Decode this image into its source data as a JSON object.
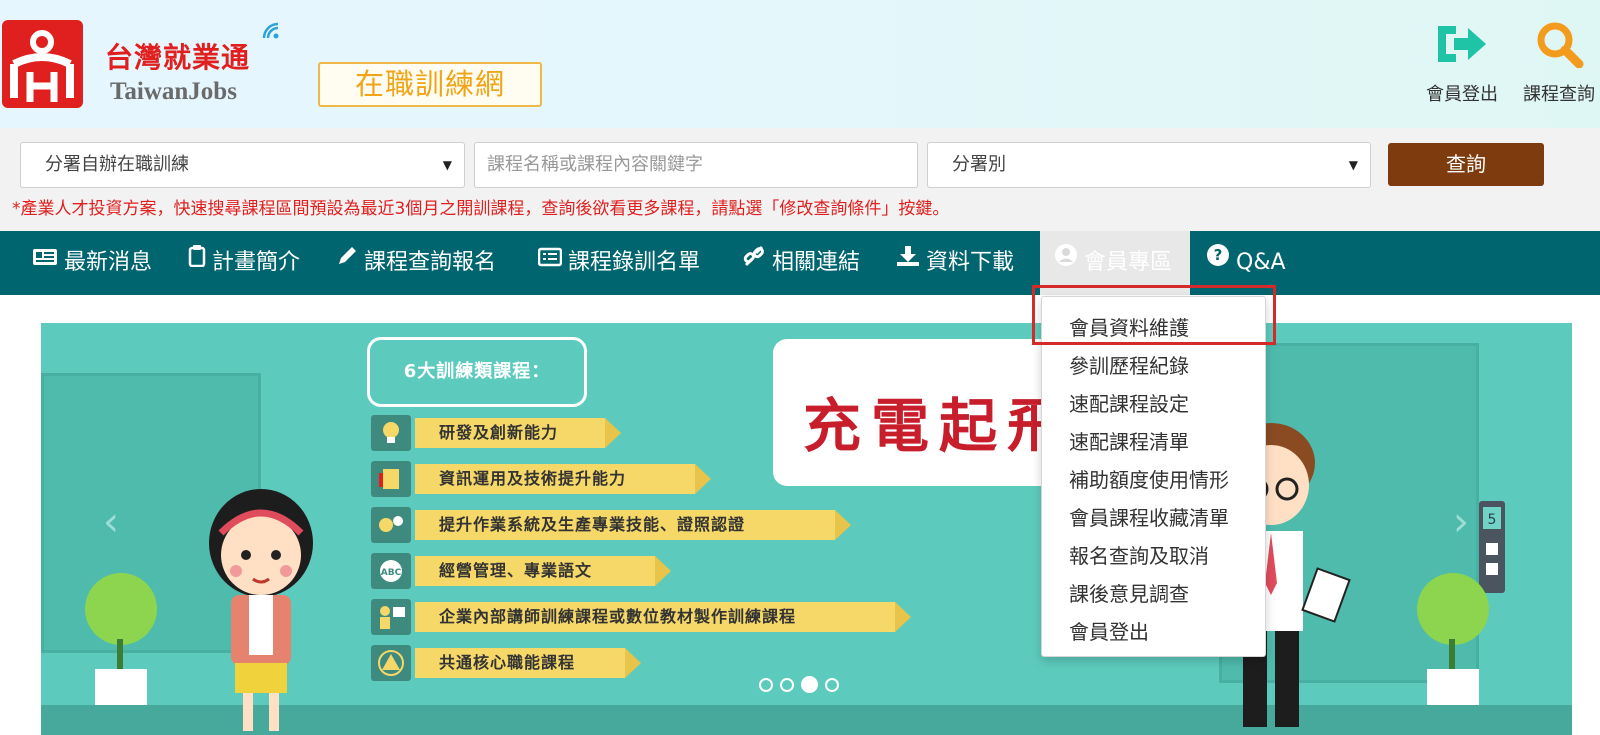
{
  "header": {
    "brand_cn": "台灣就業通",
    "brand_en": "TaiwanJobs",
    "portal_name": "在職訓練網",
    "logout_label": "會員登出",
    "course_search_label": "課程查詢"
  },
  "search": {
    "category_value": "分署自辦在職訓練",
    "keyword_placeholder": "課程名稱或課程內容關鍵字",
    "branch_value": "分署別",
    "query_button": "查詢",
    "notice": "*產業人才投資方案，快速搜尋課程區間預設為最近3個月之開訓課程，查詢後欲看更多課程，請點選「修改查詢條件」按鍵。"
  },
  "nav": {
    "items": [
      {
        "label": "最新消息",
        "icon": "news-icon"
      },
      {
        "label": "計畫簡介",
        "icon": "clipboard-icon"
      },
      {
        "label": "課程查詢報名",
        "icon": "pencil-icon"
      },
      {
        "label": "課程錄訓名單",
        "icon": "list-icon"
      },
      {
        "label": "相關連結",
        "icon": "link-icon"
      },
      {
        "label": "資料下載",
        "icon": "download-icon"
      },
      {
        "label": "會員專區",
        "icon": "user-circle-icon"
      },
      {
        "label": "Q&A",
        "icon": "question-circle-icon"
      }
    ]
  },
  "member_menu": {
    "items": [
      "會員資料維護",
      "參訓歷程紀錄",
      "速配課程設定",
      "速配課程清單",
      "補助額度使用情形",
      "會員課程收藏清單",
      "報名查詢及取消",
      "課後意見調查",
      "會員登出"
    ]
  },
  "banner": {
    "tag": "6大訓練類課程：",
    "slogan": "充電起飛",
    "courses": [
      "研發及創新能力",
      "資訊運用及技術提升能力",
      "提升作業系統及生產專業技能、證照認證",
      "經營管理、專業語文",
      "企業內部講師訓練課程或數位教材製作訓練課程",
      "共通核心職能課程"
    ],
    "abc_badge": "ABC",
    "elevator_floor": "5",
    "active_slide": 3,
    "slide_count": 4
  },
  "colors": {
    "brand_red": "#e0201f",
    "nav_bg": "#00656f",
    "query_button": "#7d3b0e",
    "banner_bg": "#5ccbbd",
    "ribbon": "#f5d867",
    "highlight_box": "#d42a2a",
    "portal_orange": "#f0a418"
  }
}
